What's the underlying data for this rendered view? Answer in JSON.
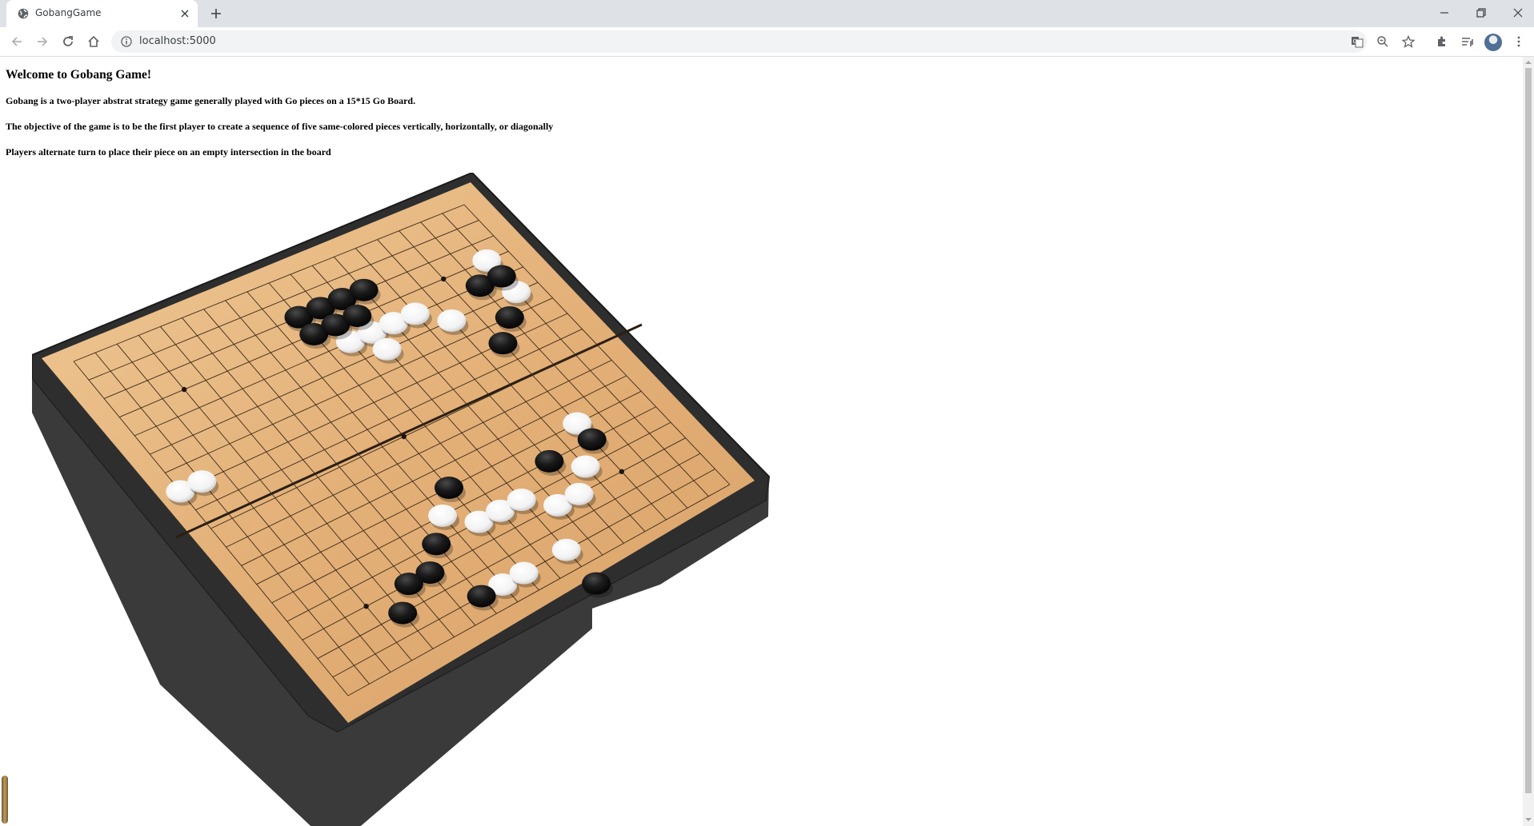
{
  "tab": {
    "title": "GobangGame"
  },
  "address": {
    "url": "localhost:5000"
  },
  "page": {
    "heading": "Welcome to Gobang Game!",
    "paragraphs": [
      "Gobang is a two-player abstrat strategy game generally played with Go pieces on a 15*15 Go Board.",
      "The objective of the game is to be the first player to create a sequence of five same-colored pieces vertically, horizontally, or diagonally",
      "Players alternate turn to place their piece on an empty intersection in the board"
    ]
  },
  "board": {
    "size": 19,
    "colors": {
      "wood": "#e5b47c",
      "frame": "#2e2e2e",
      "black": "#151515",
      "white": "#fafafa"
    },
    "stars": [
      [
        3,
        3
      ],
      [
        3,
        15
      ],
      [
        9,
        9
      ],
      [
        15,
        3
      ],
      [
        15,
        15
      ]
    ],
    "black_stones": [
      [
        9,
        2
      ],
      [
        10,
        2
      ],
      [
        11,
        2
      ],
      [
        12,
        2
      ],
      [
        9,
        3
      ],
      [
        10,
        3
      ],
      [
        11,
        3
      ],
      [
        16,
        4
      ],
      [
        17,
        4
      ],
      [
        16,
        6
      ],
      [
        15,
        7
      ],
      [
        13,
        13
      ],
      [
        15,
        13
      ],
      [
        9,
        12
      ],
      [
        7,
        14
      ],
      [
        6,
        15
      ],
      [
        5,
        15
      ],
      [
        4,
        16
      ],
      [
        7,
        17
      ],
      [
        11,
        19
      ]
    ],
    "white_stones": [
      [
        0,
        7
      ],
      [
        1,
        7
      ],
      [
        10,
        4
      ],
      [
        11,
        4
      ],
      [
        12,
        4
      ],
      [
        13,
        4
      ],
      [
        17,
        3
      ],
      [
        17,
        5
      ],
      [
        11,
        5
      ],
      [
        14,
        5
      ],
      [
        8,
        13
      ],
      [
        9,
        14
      ],
      [
        10,
        14
      ],
      [
        11,
        14
      ],
      [
        12,
        15
      ],
      [
        15,
        12
      ],
      [
        14,
        14
      ],
      [
        8,
        17
      ],
      [
        9,
        17
      ],
      [
        13,
        15
      ],
      [
        11,
        17
      ]
    ]
  }
}
